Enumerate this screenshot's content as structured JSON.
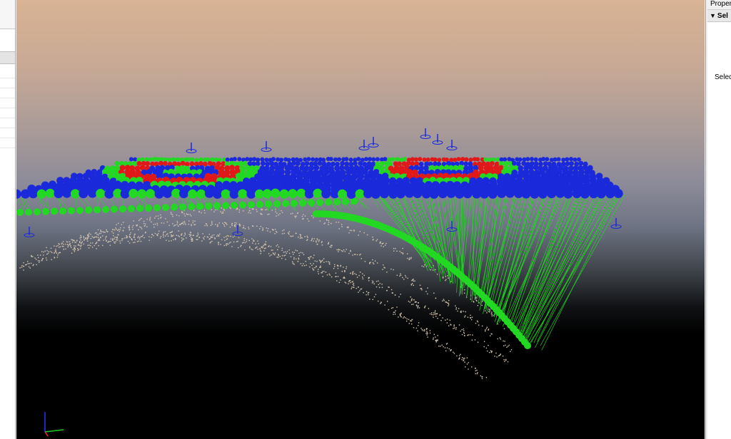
{
  "right_panel": {
    "title": "Proper",
    "section_label": "Sel",
    "field_label": "Select",
    "expand_icon": "triangle-down-icon"
  },
  "viewport": {
    "description_icons": {
      "axis": "axis-triad-icon"
    },
    "colors": {
      "sky_top": "#d8b394",
      "sky_horizon": "#6d7282",
      "ground": "#000000",
      "marker_blue": "#1a2adb",
      "marker_green": "#22d822",
      "marker_red": "#e01818",
      "point_cloud": "#d8c7b0"
    }
  }
}
